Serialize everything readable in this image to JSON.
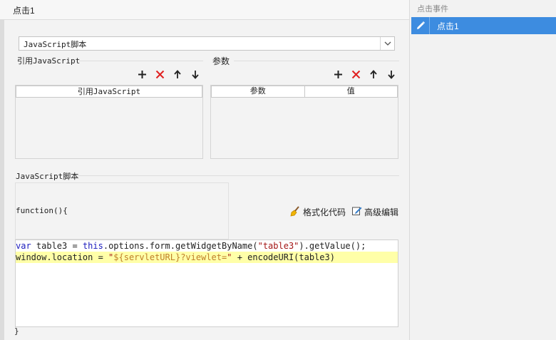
{
  "window": {
    "title": "点击1"
  },
  "script_type": {
    "selected": "JavaScript脚本"
  },
  "refs": {
    "label": "引用JavaScript",
    "columns": [
      "引用JavaScript"
    ]
  },
  "params": {
    "label": "参数",
    "columns": [
      "参数",
      "值"
    ]
  },
  "toolbar_icons": [
    "plus-icon",
    "delete-x-icon",
    "arrow-up-icon",
    "arrow-down-icon"
  ],
  "script": {
    "label": "JavaScript脚本",
    "function_head": "function(){",
    "function_tail": "}",
    "format_label": "格式化代码",
    "advanced_label": "高级编辑",
    "line1": {
      "kw_var": "var",
      "p1": " table3 = ",
      "kw_this": "this",
      "p2": ".options.form.getWidgetByName(",
      "s1": "\"table3\"",
      "p3": ").getValue();"
    },
    "line2": {
      "p1": "window.location = ",
      "s_open": "\"",
      "tpl": "${servletURL}?viewlet=",
      "s_close": "\"",
      "p2": " + encodeURI(table3)"
    }
  },
  "events": {
    "title": "点击事件",
    "items": [
      {
        "label": "点击1",
        "icon": "pencil-icon"
      }
    ]
  },
  "colors": {
    "accent": "#3d8ce0",
    "delete_red": "#e02020",
    "keyword": "#1b1bbd",
    "string": "#a31515",
    "highlight": "#ffffa8"
  }
}
